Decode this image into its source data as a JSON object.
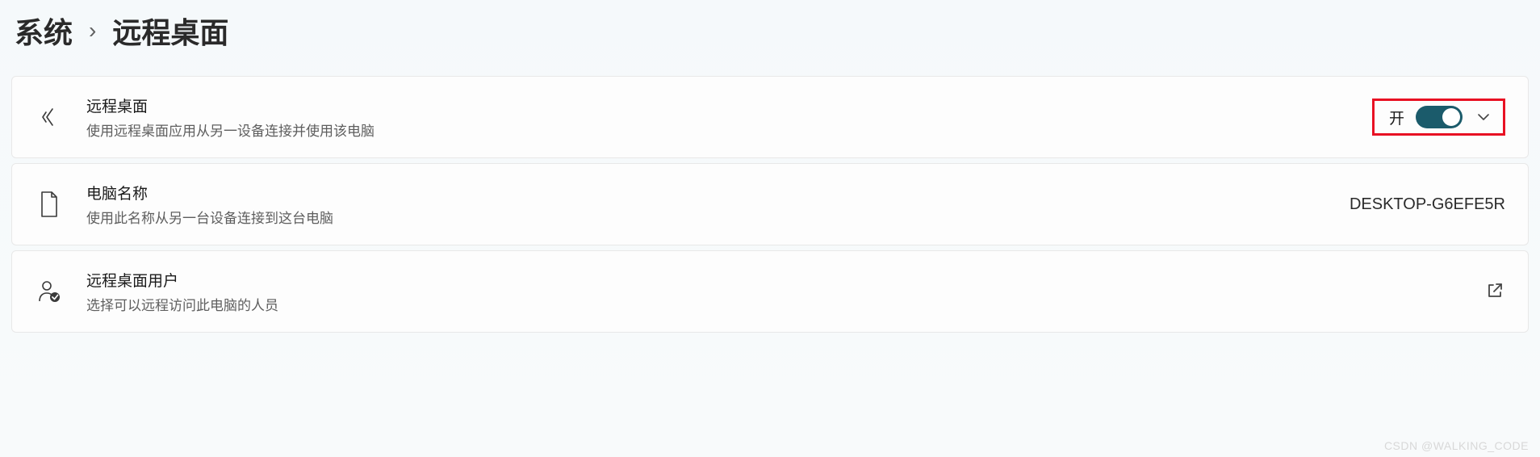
{
  "breadcrumb": {
    "parent": "系统",
    "separator": "›",
    "current": "远程桌面"
  },
  "settings": {
    "remote_desktop": {
      "title": "远程桌面",
      "desc": "使用远程桌面应用从另一设备连接并使用该电脑",
      "toggle_label": "开",
      "toggle_on": true
    },
    "pc_name": {
      "title": "电脑名称",
      "desc": "使用此名称从另一台设备连接到这台电脑",
      "value": "DESKTOP-G6EFE5R"
    },
    "rd_users": {
      "title": "远程桌面用户",
      "desc": "选择可以远程访问此电脑的人员"
    }
  },
  "watermark": "CSDN @WALKING_CODE"
}
